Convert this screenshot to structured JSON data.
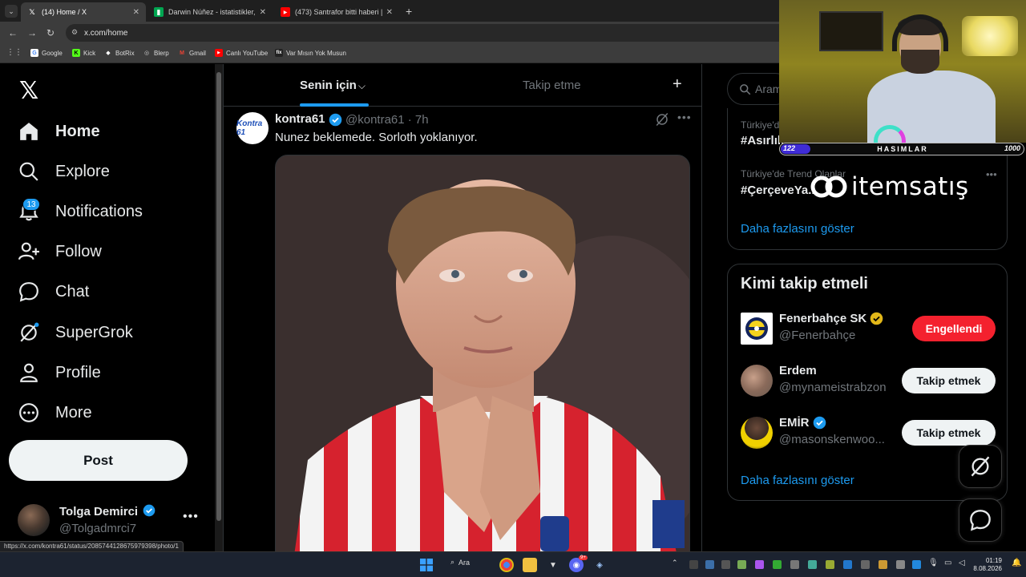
{
  "browser": {
    "tabs": [
      {
        "title": "(14) Home / X",
        "icon": "x-icon",
        "active": true
      },
      {
        "title": "Darwin Núñez - istatistikler, kar...",
        "icon": "flashscore-icon",
        "active": false
      },
      {
        "title": "(473) Santrafor bitti haberi | Sö...",
        "icon": "youtube-icon",
        "active": false
      }
    ],
    "url": "x.com/home",
    "bookmarks": [
      {
        "label": "Google",
        "icon": "google-icon",
        "color": "#4285f4"
      },
      {
        "label": "Kick",
        "icon": "kick-icon",
        "color": "#53fc18"
      },
      {
        "label": "BotRix",
        "icon": "botrix-icon",
        "color": "#ffffff"
      },
      {
        "label": "Blerp",
        "icon": "blerp-icon",
        "color": "#cccccc"
      },
      {
        "label": "Gmail",
        "icon": "gmail-icon",
        "color": "#ea4335"
      },
      {
        "label": "Canlı YouTube",
        "icon": "youtube-icon",
        "color": "#ff0000"
      },
      {
        "label": "Var Mısın Yok Musun",
        "icon": "fix-icon",
        "color": "#222222"
      }
    ],
    "status_url": "https://x.com/kontra61/status/2085744128675979398/photo/1"
  },
  "sidebar": {
    "items": [
      {
        "label": "Home",
        "icon": "home-icon",
        "active": true
      },
      {
        "label": "Explore",
        "icon": "search-icon"
      },
      {
        "label": "Notifications",
        "icon": "bell-icon"
      },
      {
        "label": "Follow",
        "icon": "add-person-icon"
      },
      {
        "label": "Chat",
        "icon": "chat-icon"
      },
      {
        "label": "SuperGrok",
        "icon": "grok-icon"
      },
      {
        "label": "Profile",
        "icon": "person-icon"
      },
      {
        "label": "More",
        "icon": "more-circle-icon"
      }
    ],
    "notif_count": "13",
    "post_label": "Post",
    "account": {
      "name": "Tolga Demirci",
      "handle": "@Tolgadmrci7"
    }
  },
  "feed": {
    "tabs": [
      "Senin için",
      "Takip etme"
    ],
    "tweet": {
      "avatar_text": "Kontra 61",
      "name": "kontra61",
      "handle": "@kontra61 · 7h",
      "text": "Nunez beklemede. Sorloth yoklanıyor."
    }
  },
  "right": {
    "search_placeholder": "Aram",
    "trends": [
      {
        "context": "Türkiye'de...",
        "title": "#Asırlık..."
      },
      {
        "context": "Türkiye'de Trend Olanlar",
        "title": "#ÇerçeveYa..."
      }
    ],
    "trends_show_more": "Daha fazlasını göster",
    "who_title": "Kimi takip etmeli",
    "who": [
      {
        "name": "Fenerbahçe SK",
        "handle": "@Fenerbahçe",
        "verified": "gold",
        "button": "Engellendi",
        "button_style": "red"
      },
      {
        "name": "Erdem",
        "handle": "@mynameistrabzon",
        "verified": "",
        "button": "Takip etmek",
        "button_style": "light"
      },
      {
        "name": "EMİR",
        "handle": "@masonskenwoo...",
        "verified": "blue",
        "button": "Takip etmek",
        "button_style": "light"
      }
    ],
    "who_show_more": "Daha fazlasını göster"
  },
  "overlay": {
    "bar_left": "122",
    "bar_title": "HASIMLAR",
    "bar_right": "1000",
    "bar_progress": 0.122,
    "brand": "itemsatış"
  },
  "taskbar": {
    "search": "Ara",
    "time": "01:19",
    "date": "8.08.2026",
    "discord_badge": "9+"
  },
  "colors": {
    "accent": "#1d9bf0",
    "red_button": "#f4212e",
    "gold_verified": "#e2b719"
  }
}
